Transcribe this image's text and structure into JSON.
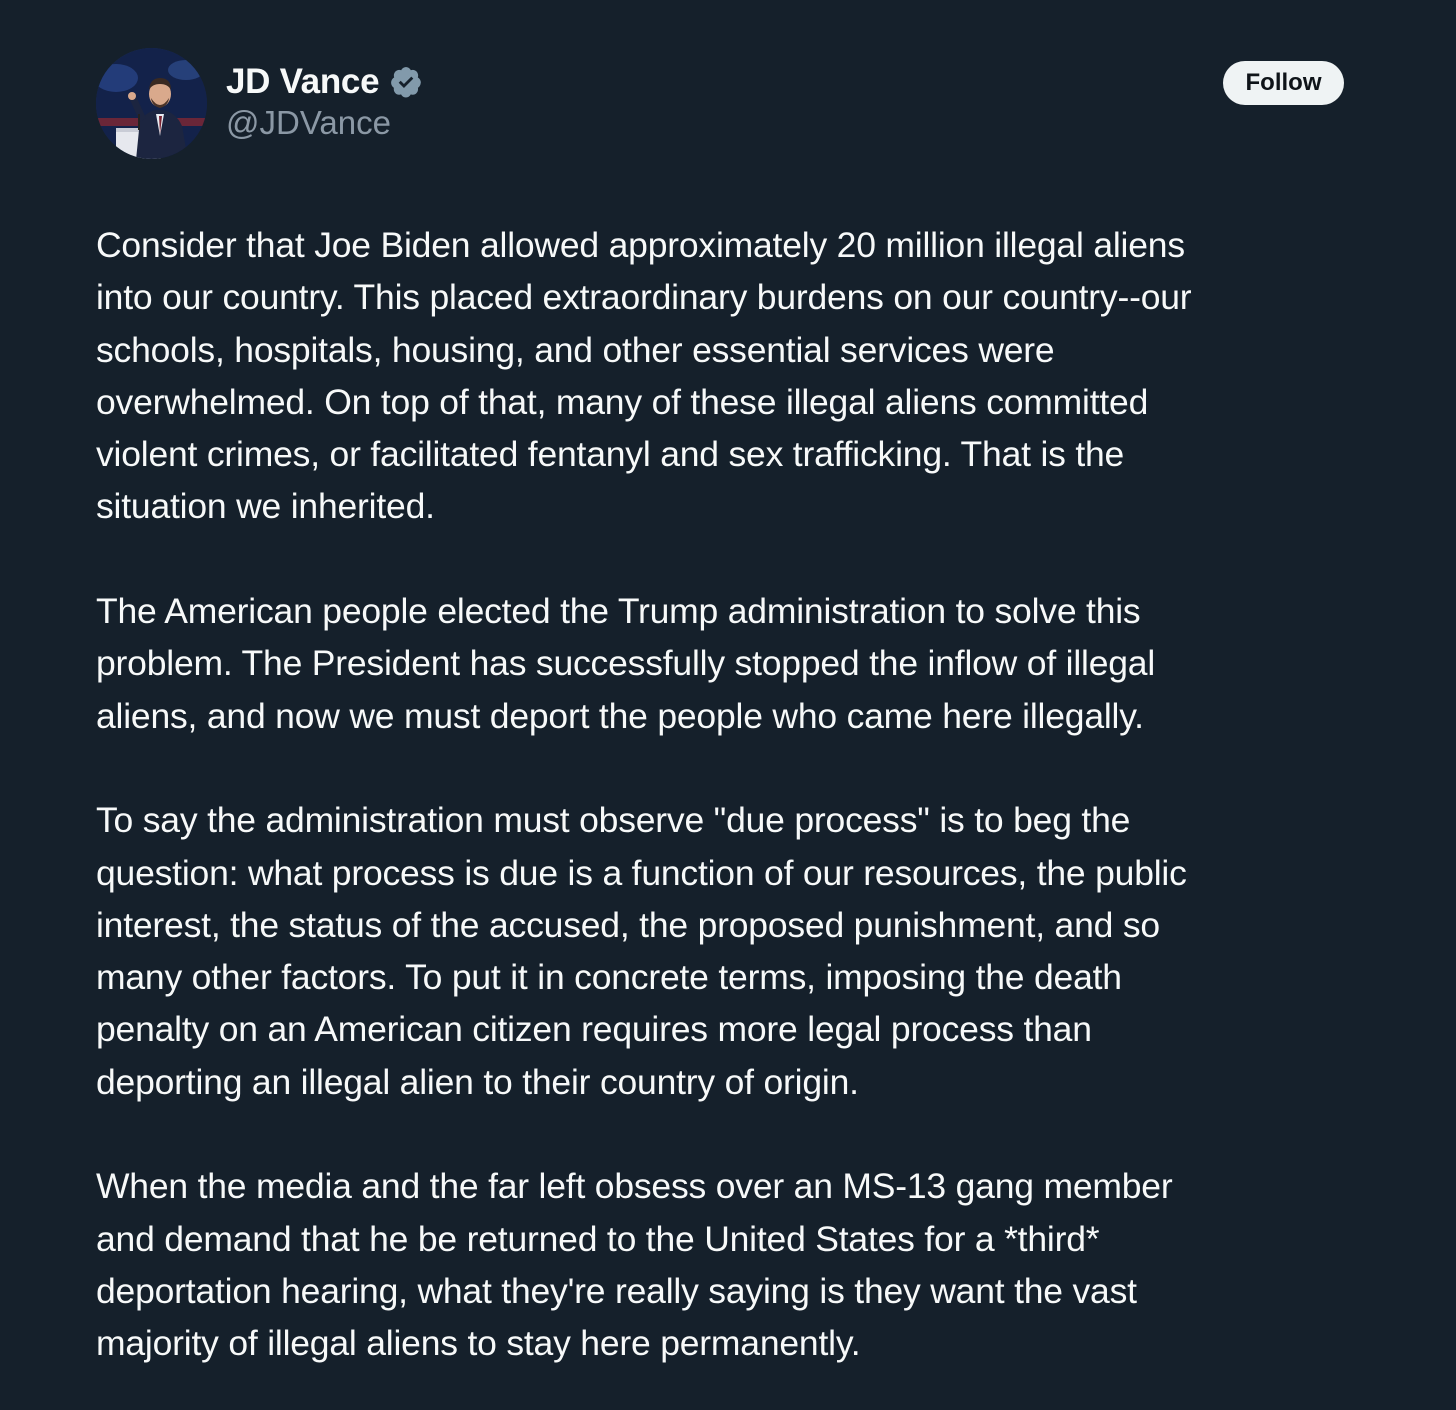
{
  "author": {
    "name": "JD Vance",
    "handle": "@JDVance",
    "verified": true,
    "verified_color": "#829aab",
    "avatar": "profile-photo"
  },
  "actions": {
    "follow_label": "Follow"
  },
  "tweet": {
    "lines": [
      [
        "Consider that Joe Biden allowed approximately 20 million illegal aliens",
        "into our country. This placed extraordinary burdens on our country--our",
        "schools, hospitals, housing, and other essential services were",
        "overwhelmed. On top of that, many of these illegal aliens committed",
        "violent crimes, or facilitated fentanyl and sex trafficking. That is the",
        "situation we inherited."
      ],
      [
        "The American people elected the Trump administration to solve this",
        "problem. The President has successfully stopped the inflow of illegal",
        "aliens, and now we must deport the people who came here illegally."
      ],
      [
        "To say the administration must observe \"due process\" is to beg the",
        "question: what process is due is a function of our resources, the public",
        "interest, the status of the accused, the proposed punishment, and so",
        "many other factors. To put it in concrete terms, imposing the death",
        "penalty on an American citizen requires more legal process than",
        "deporting an illegal alien to their country of origin."
      ],
      [
        "When the media and the far left obsess over an MS-13 gang member",
        "and demand that he be returned to the United States for a *third*",
        "deportation hearing, what they're really saying is they want the vast",
        "majority of illegal aliens to stay here permanently."
      ]
    ]
  },
  "colors": {
    "background": "#15202b",
    "text": "#f7f9f9",
    "secondary_text": "#8b98a5",
    "button_bg": "#eff3f4",
    "button_text": "#0f1419"
  }
}
